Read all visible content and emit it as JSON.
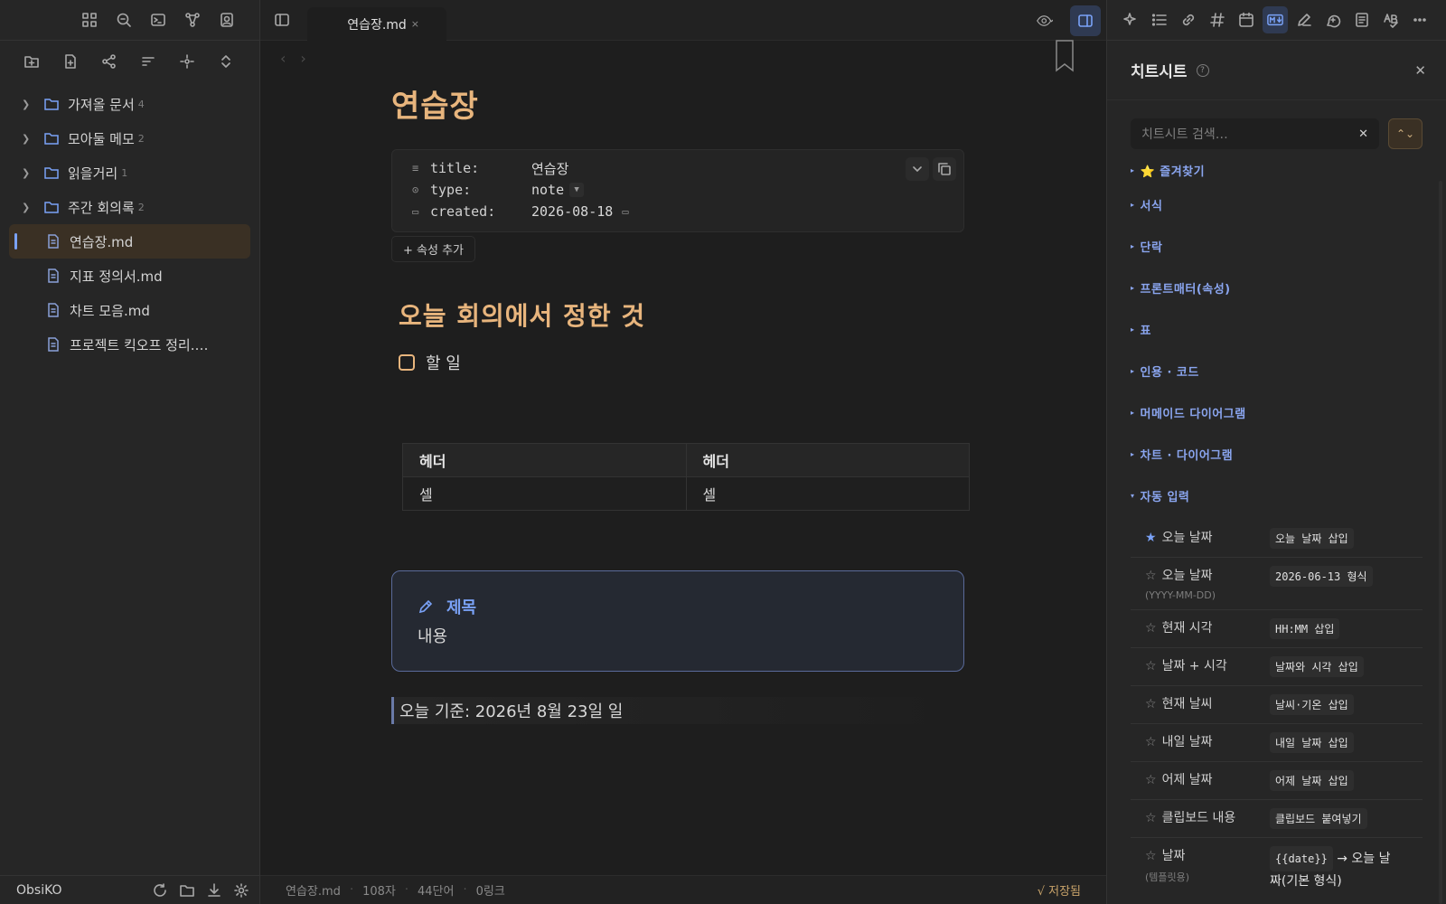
{
  "app": {
    "vault_name": "ObsiKO"
  },
  "file_tree": {
    "folders": [
      {
        "name": "가져올 문서",
        "count": "4"
      },
      {
        "name": "모아둘 메모",
        "count": "2"
      },
      {
        "name": "읽을거리",
        "count": "1"
      },
      {
        "name": "주간 회의록",
        "count": "2"
      }
    ],
    "files": [
      {
        "name": "연습장.md"
      },
      {
        "name": "지표 정의서.md"
      },
      {
        "name": "차트 모음.md"
      },
      {
        "name": "프로젝트 킥오프 정리.…"
      }
    ]
  },
  "tab": {
    "title": "연습장.md",
    "close": "×"
  },
  "nav": {
    "back": "‹",
    "forward": "›"
  },
  "document": {
    "title": "연습장",
    "properties": [
      {
        "key": "title:",
        "value": "연습장"
      },
      {
        "key": "type:",
        "value": "note"
      },
      {
        "key": "created:",
        "value": "2026-08-18"
      }
    ],
    "add_property": "+ 속성 추가",
    "heading": "오늘 회의에서 정한 것",
    "task": "할 일",
    "table": {
      "headers": [
        "헤더",
        "헤더"
      ],
      "rows": [
        [
          "셀",
          "셀"
        ]
      ]
    },
    "callout": {
      "title": "제목",
      "body": "내용"
    },
    "quote": "오늘 기준: 2026년 8월 23일 일"
  },
  "status_bar": {
    "file": "연습장.md",
    "chars": "108자",
    "words": "44단어",
    "links": "0링크",
    "saved": "√ 저장됨"
  },
  "cheatsheet": {
    "title": "치트시트",
    "help": "?",
    "close": "✕",
    "search_placeholder": "치트시트 검색…",
    "search_clear": "✕",
    "sort": "⌃⌄",
    "sections": [
      "⭐ 즐겨찾기",
      "서식",
      "단락",
      "프론트매터(속성)",
      "표",
      "인용 · 코드",
      "머메이드 다이어그램",
      "차트 · 다이어그램"
    ],
    "open_section": "자동 입력",
    "items": [
      {
        "name": "오늘 날짜",
        "sub": "",
        "value": "오늘 날짜 삽입",
        "star": "★"
      },
      {
        "name": "오늘 날짜",
        "sub": "(YYYY-MM-DD)",
        "value": "2026-06-13 형식",
        "star": "☆"
      },
      {
        "name": "현재 시각",
        "sub": "",
        "value": "HH:MM 삽입",
        "star": "☆"
      },
      {
        "name": "날짜 + 시각",
        "sub": "",
        "value": "날짜와 시각 삽입",
        "star": "☆"
      },
      {
        "name": "현재 날씨",
        "sub": "",
        "value": "날씨·기온 삽입",
        "star": "☆"
      },
      {
        "name": "내일 날짜",
        "sub": "",
        "value": "내일 날짜 삽입",
        "star": "☆"
      },
      {
        "name": "어제 날짜",
        "sub": "",
        "value": "어제 날짜 삽입",
        "star": "☆"
      },
      {
        "name": "클립보드 내용",
        "sub": "",
        "value": "클립보드 붙여넣기",
        "star": "☆"
      },
      {
        "name": "날짜",
        "sub": "(템플릿용)",
        "value_chip": "{{date}}",
        "value_text": "→ 오늘 날짜(기본 형식)",
        "star": "☆"
      }
    ]
  },
  "colors": {
    "accent": "#7aa2f7",
    "heading": "#e8b57d",
    "background": "#1e1e1e",
    "sidebar": "#262626"
  }
}
